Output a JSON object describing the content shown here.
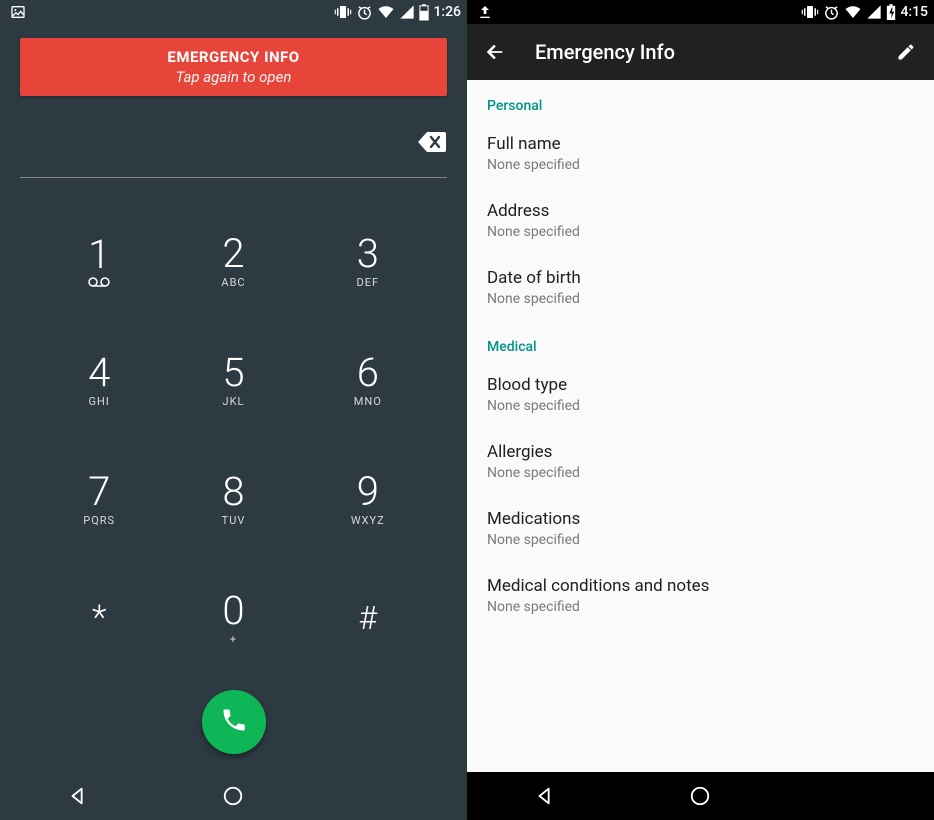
{
  "left": {
    "status": {
      "time": "1:26"
    },
    "banner": {
      "title": "EMERGENCY INFO",
      "subtitle": "Tap again to open"
    },
    "keys": [
      {
        "digit": "1",
        "letters": ""
      },
      {
        "digit": "2",
        "letters": "ABC"
      },
      {
        "digit": "3",
        "letters": "DEF"
      },
      {
        "digit": "4",
        "letters": "GHI"
      },
      {
        "digit": "5",
        "letters": "JKL"
      },
      {
        "digit": "6",
        "letters": "MNO"
      },
      {
        "digit": "7",
        "letters": "PQRS"
      },
      {
        "digit": "8",
        "letters": "TUV"
      },
      {
        "digit": "9",
        "letters": "WXYZ"
      },
      {
        "digit": "*",
        "letters": ""
      },
      {
        "digit": "0",
        "letters": "+"
      },
      {
        "digit": "#",
        "letters": ""
      }
    ]
  },
  "right": {
    "status": {
      "time": "4:15"
    },
    "appbar": {
      "title": "Emergency Info"
    },
    "sections": [
      {
        "header": "Personal",
        "items": [
          {
            "label": "Full name",
            "value": "None specified"
          },
          {
            "label": "Address",
            "value": "None specified"
          },
          {
            "label": "Date of birth",
            "value": "None specified"
          }
        ]
      },
      {
        "header": "Medical",
        "items": [
          {
            "label": "Blood type",
            "value": "None specified"
          },
          {
            "label": "Allergies",
            "value": "None specified"
          },
          {
            "label": "Medications",
            "value": "None specified"
          },
          {
            "label": "Medical conditions and notes",
            "value": "None specified"
          }
        ]
      }
    ]
  }
}
